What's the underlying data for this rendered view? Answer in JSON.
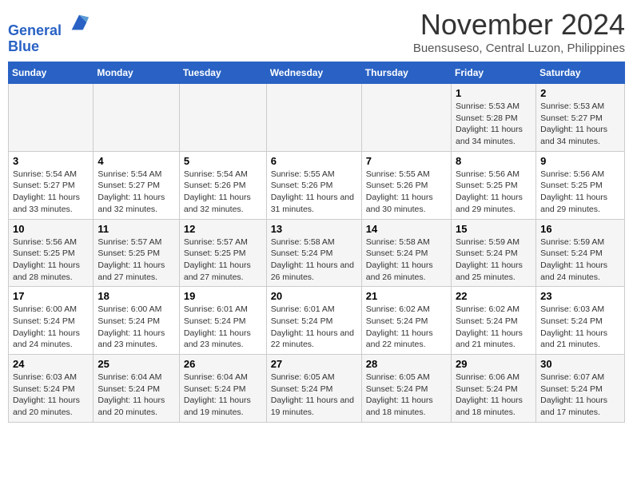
{
  "header": {
    "logo_line1": "General",
    "logo_line2": "Blue",
    "month": "November 2024",
    "location": "Buensuseso, Central Luzon, Philippines"
  },
  "weekdays": [
    "Sunday",
    "Monday",
    "Tuesday",
    "Wednesday",
    "Thursday",
    "Friday",
    "Saturday"
  ],
  "weeks": [
    [
      null,
      null,
      null,
      null,
      null,
      {
        "day": 1,
        "sunrise": "5:53 AM",
        "sunset": "5:28 PM",
        "daylight": "11 hours and 34 minutes."
      },
      {
        "day": 2,
        "sunrise": "5:53 AM",
        "sunset": "5:27 PM",
        "daylight": "11 hours and 34 minutes."
      }
    ],
    [
      {
        "day": 3,
        "sunrise": "5:54 AM",
        "sunset": "5:27 PM",
        "daylight": "11 hours and 33 minutes."
      },
      {
        "day": 4,
        "sunrise": "5:54 AM",
        "sunset": "5:27 PM",
        "daylight": "11 hours and 32 minutes."
      },
      {
        "day": 5,
        "sunrise": "5:54 AM",
        "sunset": "5:26 PM",
        "daylight": "11 hours and 32 minutes."
      },
      {
        "day": 6,
        "sunrise": "5:55 AM",
        "sunset": "5:26 PM",
        "daylight": "11 hours and 31 minutes."
      },
      {
        "day": 7,
        "sunrise": "5:55 AM",
        "sunset": "5:26 PM",
        "daylight": "11 hours and 30 minutes."
      },
      {
        "day": 8,
        "sunrise": "5:56 AM",
        "sunset": "5:25 PM",
        "daylight": "11 hours and 29 minutes."
      },
      {
        "day": 9,
        "sunrise": "5:56 AM",
        "sunset": "5:25 PM",
        "daylight": "11 hours and 29 minutes."
      }
    ],
    [
      {
        "day": 10,
        "sunrise": "5:56 AM",
        "sunset": "5:25 PM",
        "daylight": "11 hours and 28 minutes."
      },
      {
        "day": 11,
        "sunrise": "5:57 AM",
        "sunset": "5:25 PM",
        "daylight": "11 hours and 27 minutes."
      },
      {
        "day": 12,
        "sunrise": "5:57 AM",
        "sunset": "5:25 PM",
        "daylight": "11 hours and 27 minutes."
      },
      {
        "day": 13,
        "sunrise": "5:58 AM",
        "sunset": "5:24 PM",
        "daylight": "11 hours and 26 minutes."
      },
      {
        "day": 14,
        "sunrise": "5:58 AM",
        "sunset": "5:24 PM",
        "daylight": "11 hours and 26 minutes."
      },
      {
        "day": 15,
        "sunrise": "5:59 AM",
        "sunset": "5:24 PM",
        "daylight": "11 hours and 25 minutes."
      },
      {
        "day": 16,
        "sunrise": "5:59 AM",
        "sunset": "5:24 PM",
        "daylight": "11 hours and 24 minutes."
      }
    ],
    [
      {
        "day": 17,
        "sunrise": "6:00 AM",
        "sunset": "5:24 PM",
        "daylight": "11 hours and 24 minutes."
      },
      {
        "day": 18,
        "sunrise": "6:00 AM",
        "sunset": "5:24 PM",
        "daylight": "11 hours and 23 minutes."
      },
      {
        "day": 19,
        "sunrise": "6:01 AM",
        "sunset": "5:24 PM",
        "daylight": "11 hours and 23 minutes."
      },
      {
        "day": 20,
        "sunrise": "6:01 AM",
        "sunset": "5:24 PM",
        "daylight": "11 hours and 22 minutes."
      },
      {
        "day": 21,
        "sunrise": "6:02 AM",
        "sunset": "5:24 PM",
        "daylight": "11 hours and 22 minutes."
      },
      {
        "day": 22,
        "sunrise": "6:02 AM",
        "sunset": "5:24 PM",
        "daylight": "11 hours and 21 minutes."
      },
      {
        "day": 23,
        "sunrise": "6:03 AM",
        "sunset": "5:24 PM",
        "daylight": "11 hours and 21 minutes."
      }
    ],
    [
      {
        "day": 24,
        "sunrise": "6:03 AM",
        "sunset": "5:24 PM",
        "daylight": "11 hours and 20 minutes."
      },
      {
        "day": 25,
        "sunrise": "6:04 AM",
        "sunset": "5:24 PM",
        "daylight": "11 hours and 20 minutes."
      },
      {
        "day": 26,
        "sunrise": "6:04 AM",
        "sunset": "5:24 PM",
        "daylight": "11 hours and 19 minutes."
      },
      {
        "day": 27,
        "sunrise": "6:05 AM",
        "sunset": "5:24 PM",
        "daylight": "11 hours and 19 minutes."
      },
      {
        "day": 28,
        "sunrise": "6:05 AM",
        "sunset": "5:24 PM",
        "daylight": "11 hours and 18 minutes."
      },
      {
        "day": 29,
        "sunrise": "6:06 AM",
        "sunset": "5:24 PM",
        "daylight": "11 hours and 18 minutes."
      },
      {
        "day": 30,
        "sunrise": "6:07 AM",
        "sunset": "5:24 PM",
        "daylight": "11 hours and 17 minutes."
      }
    ]
  ]
}
